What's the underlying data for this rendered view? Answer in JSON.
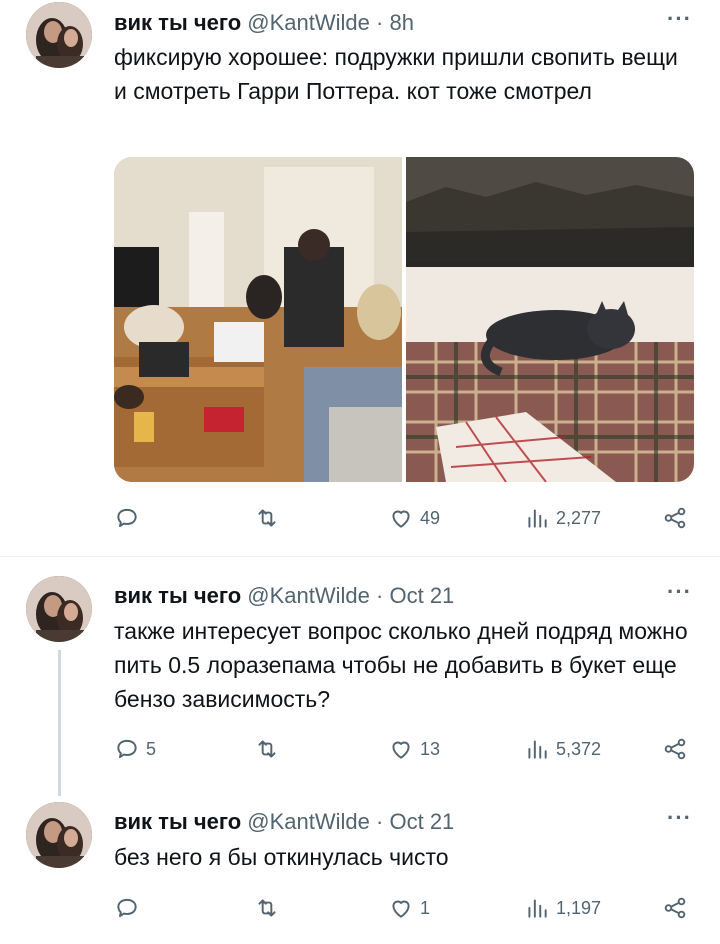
{
  "tweets": [
    {
      "name": "вик ты чего",
      "handle": "@KantWilde",
      "dot": "·",
      "time": "8h",
      "more": "···",
      "text": "фиксирую хорошее: подружки пришли свопить вещи и смотреть Гарри Поттера. кот тоже смотрел",
      "stats": {
        "reply": "",
        "retweet": "",
        "like": "49",
        "views": "2,277"
      }
    },
    {
      "name": "вик ты чего",
      "handle": "@KantWilde",
      "dot": "·",
      "time": "Oct 21",
      "more": "···",
      "text": "также интересует вопрос сколько дней подряд можно пить 0.5 лоразепама чтобы не добавить в букет еще бензо зависимость?",
      "stats": {
        "reply": "5",
        "retweet": "",
        "like": "13",
        "views": "5,372"
      }
    },
    {
      "name": "вик ты чего",
      "handle": "@KantWilde",
      "dot": "·",
      "time": "Oct 21",
      "more": "···",
      "text": "без него я бы откинулась чисто",
      "stats": {
        "reply": "",
        "retweet": "",
        "like": "1",
        "views": "1,197"
      }
    }
  ],
  "icons": [
    "reply-icon",
    "retweet-icon",
    "like-icon",
    "views-icon",
    "share-icon"
  ],
  "colors": {
    "text": "#0f1419",
    "secondary": "#536471",
    "divider": "#eff3f4"
  }
}
